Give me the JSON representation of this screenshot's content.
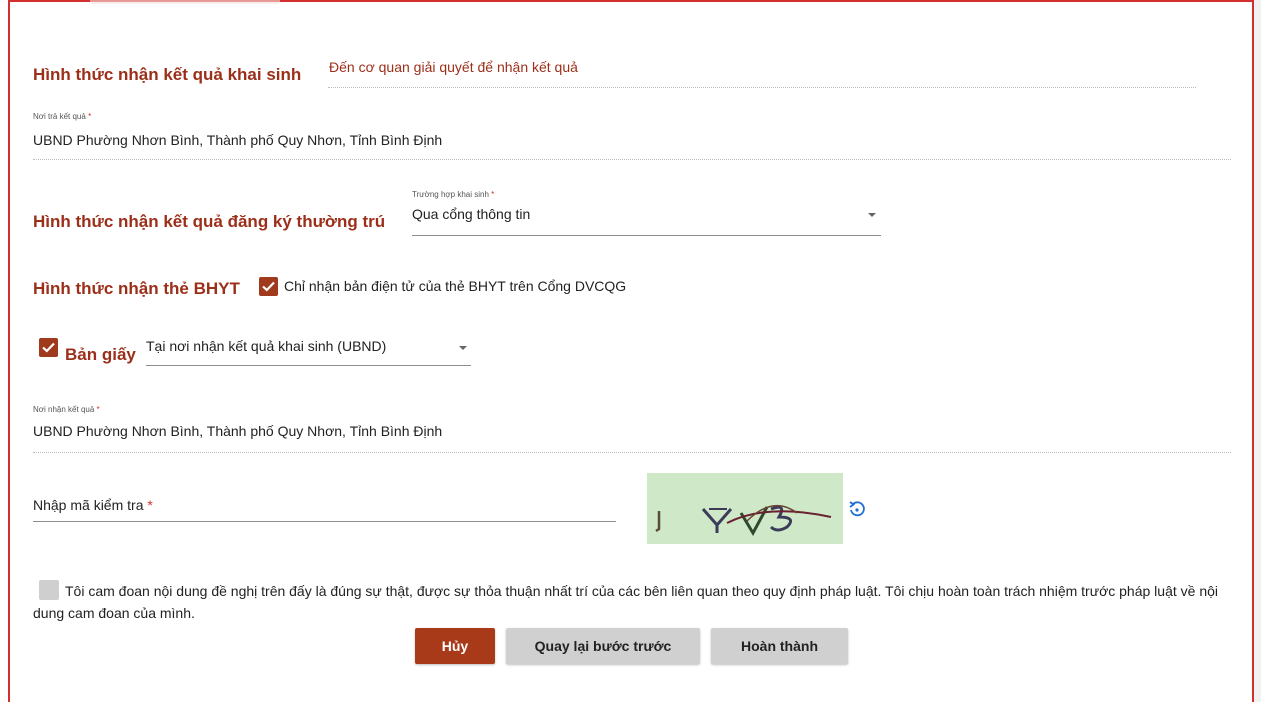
{
  "sections": {
    "birth_result": {
      "title": "Hình thức nhận kết quả khai sinh",
      "value": "Đến cơ quan giải quyết để nhận kết quả"
    },
    "return_place": {
      "label": "Nơi trả kết quả",
      "value": "UBND Phường Nhơn Bình, Thành phố Quy Nhơn, Tỉnh Bình Định"
    },
    "residence": {
      "title": "Hình thức nhận kết quả đăng ký thường trú",
      "select_label": "Trường hợp khai sinh",
      "select_value": "Qua cổng thông tin"
    },
    "bhyt": {
      "title": "Hình thức nhận thẻ BHYT",
      "electronic_label": "Chỉ nhận bản điện tử của thẻ BHYT trên Cổng DVCQG",
      "paper_label": "Bản giấy",
      "paper_select_value": "Tại nơi nhận kết quả khai sinh (UBND)"
    },
    "receive_place": {
      "label": "Nơi nhận kết quả",
      "value": "UBND Phường Nhơn Bình, Thành phố Quy Nhơn, Tỉnh Bình Định"
    },
    "captcha": {
      "label": "Nhập mã kiểm tra",
      "value": ""
    },
    "commitment": {
      "text": "Tôi cam đoan nội dung đề nghị trên đấy là đúng sự thật, được sự thỏa thuận nhất trí của các bên liên quan theo quy định pháp luật. Tôi chịu hoàn toàn trách nhiệm trước pháp luật về nội dung cam đoan của mình."
    }
  },
  "required_mark": "*",
  "buttons": {
    "cancel": "Hủy",
    "back": "Quay lại bước trước",
    "finish": "Hoàn thành"
  },
  "icons": {
    "checkbox": "check-icon",
    "dropdown": "caret-down-icon",
    "refresh": "refresh-icon"
  },
  "colors": {
    "accent": "#9c2f1a",
    "primary_button": "#a83a1a",
    "grey_button": "#d0d0d0",
    "border": "#d32f2f",
    "captcha_bg": "#cfe8c8"
  }
}
